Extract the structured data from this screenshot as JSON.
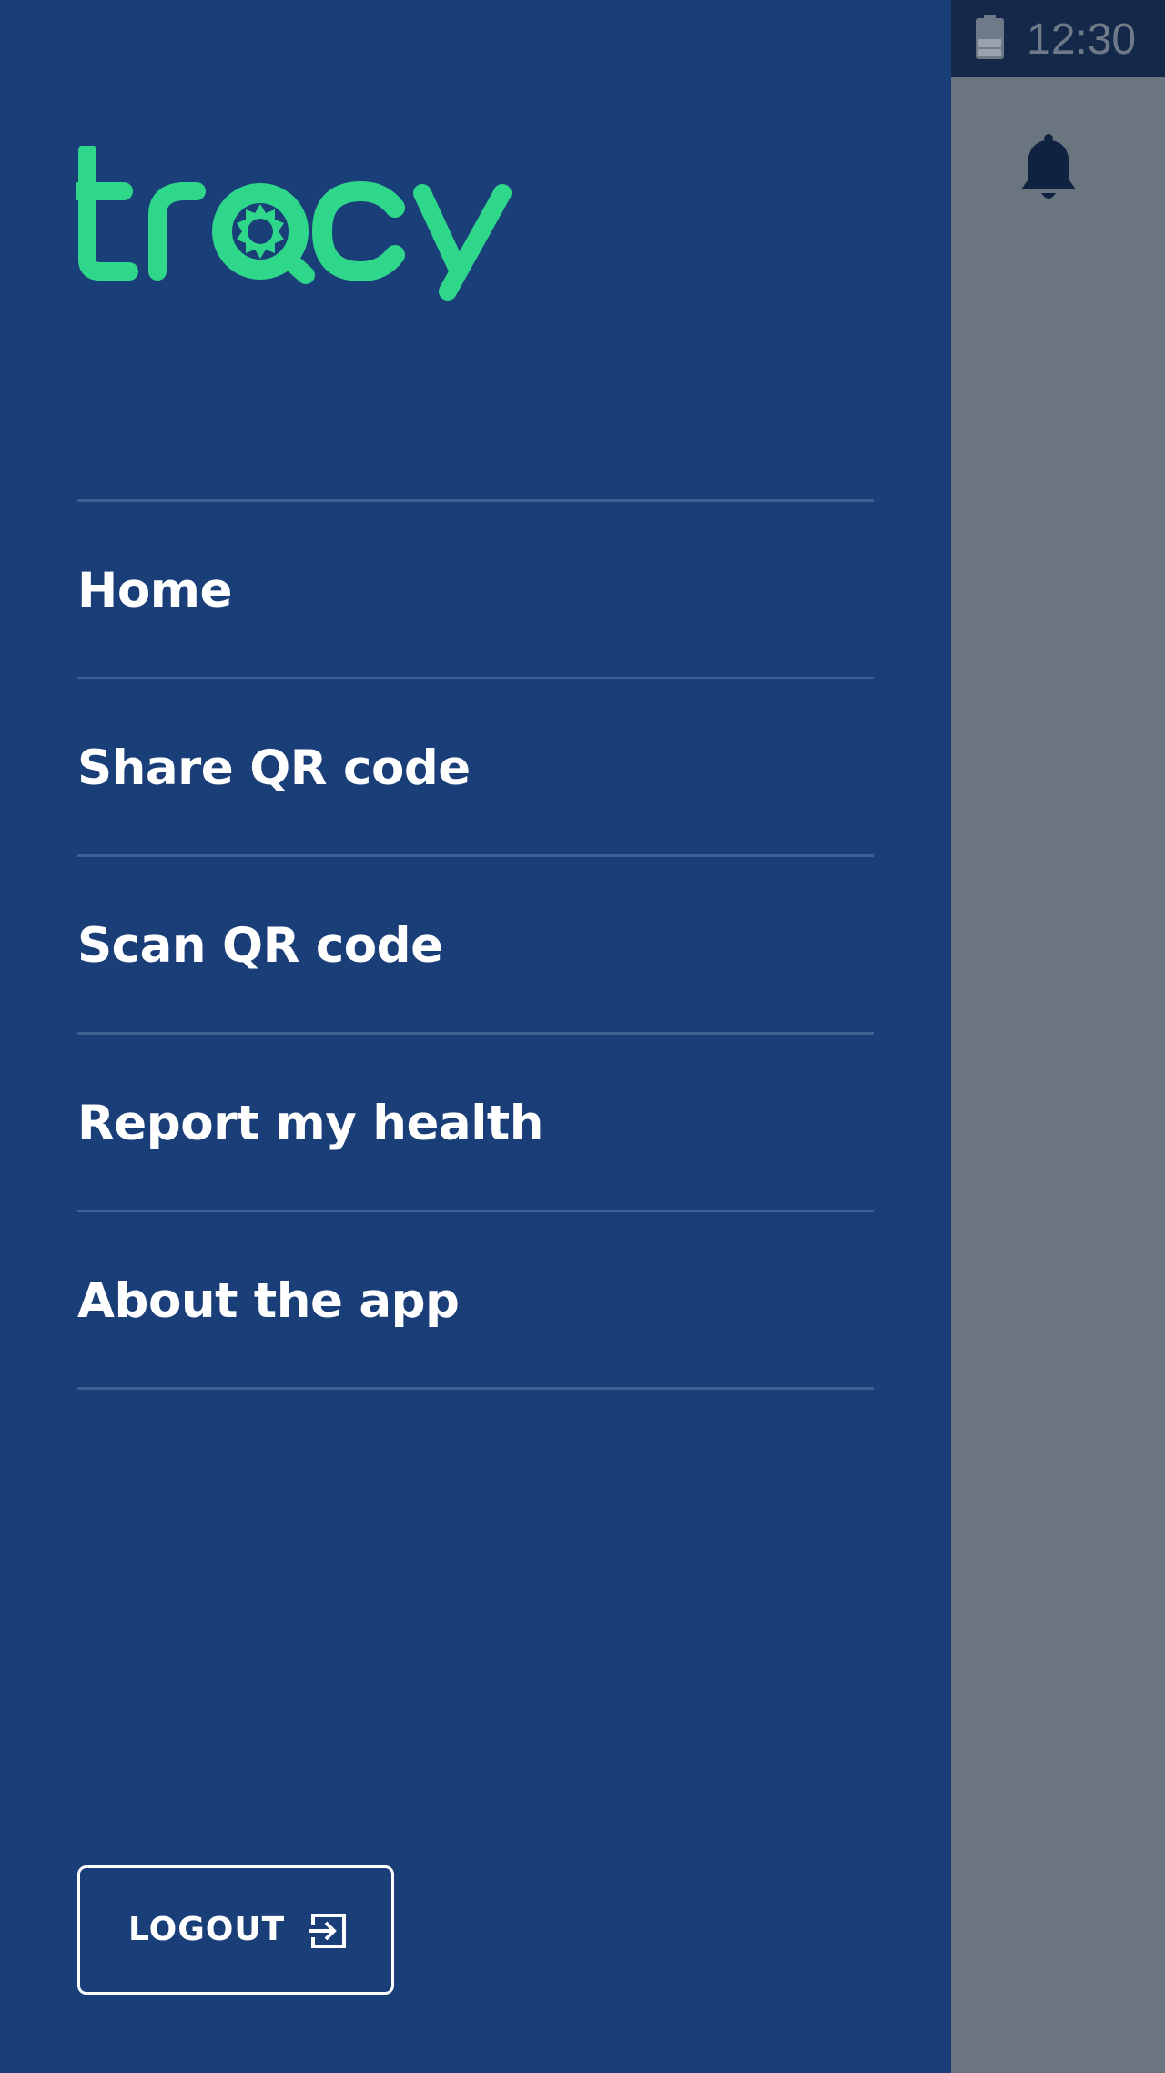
{
  "status_bar": {
    "time": "12:30",
    "battery_icon": "battery-icon"
  },
  "header": {
    "notification_icon": "bell-icon"
  },
  "drawer": {
    "logo_text": "tracy",
    "menu": [
      {
        "label": "Home"
      },
      {
        "label": "Share QR code"
      },
      {
        "label": "Scan QR code"
      },
      {
        "label": "Report my health"
      },
      {
        "label": "About the app"
      }
    ],
    "logout": {
      "label": "LOGOUT",
      "icon": "logout-icon"
    }
  },
  "colors": {
    "drawer_bg": "#1a3e78",
    "brand_green": "#2fd78b",
    "overlay": "#6b7580",
    "status_bar": "#14294a"
  }
}
